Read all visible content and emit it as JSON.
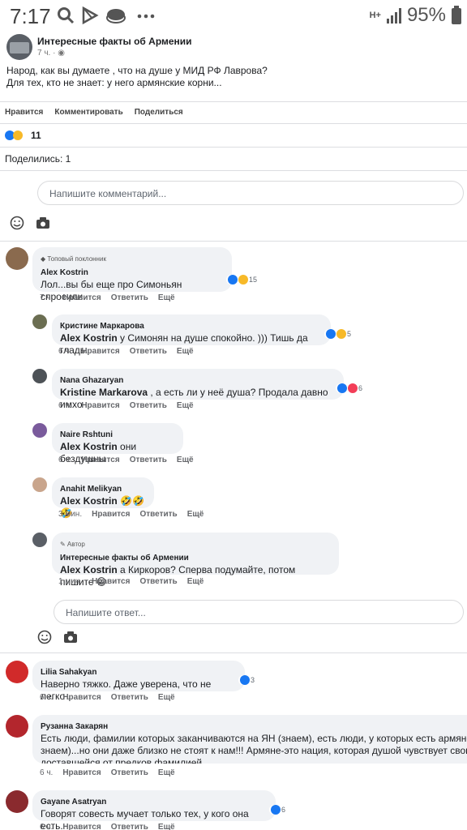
{
  "status": {
    "time": "7:17",
    "battery": "95%",
    "net": "H+"
  },
  "icons": [
    "search-icon",
    "play-store-icon",
    "messages-icon",
    "more-icon",
    "signal-icon"
  ],
  "post": {
    "page_name": "Интересные факты об Армении",
    "time": "7 ч. · ◉",
    "line1": "Народ, как вы думаете , что на душе у МИД РФ Лаврова?",
    "line2": "Для тех, кто не знает: у него армянские корни..."
  },
  "actions": {
    "like": "Нравится",
    "comment": "Комментировать",
    "share": "Поделиться"
  },
  "reactions_count": "11",
  "shares": "Поделились: 1",
  "comment_placeholder": "Напишите комментарий...",
  "reply_placeholder": "Напишите ответ...",
  "meta_labels": {
    "like": "Нравится",
    "reply": "Ответить",
    "more": "Ещё"
  },
  "comments": [
    {
      "badge": "◆ Топовый поклонник",
      "name": "Alex Kostrin",
      "text": "Лол...вы бы еще про Симоньян спросили.",
      "react_count": "15",
      "time": "7 ч."
    },
    {
      "name": "Кристине Маркарова",
      "mention": "Alex Kostrin",
      "text": " у Симонян на душе спокойно. ))) Тишь да гладь.",
      "react_count": "5",
      "time": "6 ч."
    },
    {
      "name": "Nana Ghazaryan",
      "mention": "Kristine Markarova",
      "text": " , а есть ли у неё душа? Продала давно имхо",
      "react_count": "6",
      "time": "6 ч."
    },
    {
      "name": "Naire Rshtuni",
      "mention": "Alex Kostrin",
      "text": " они бездушны",
      "time": "6 ч."
    },
    {
      "name": "Anahit Melikyan",
      "mention": "Alex Kostrin",
      "text": " 🤣🤣🤣",
      "time": "3 мин."
    },
    {
      "badge": "✎ Автор",
      "name": "Интересные факты об Армении",
      "mention": "Alex Kostrin",
      "text": " а Киркоров? Сперва подумайте, потом пишите 😁",
      "time": "1 мин."
    },
    {
      "name": "Lilia Sahakyan",
      "text": "Наверно тяжко. Даже уверена, что не легко .",
      "react_count": "3",
      "time": "6 ч."
    },
    {
      "name": "Рузанна Закарян",
      "text1": "Есть люди, фамилии которых заканчиваются на ЯН (знаем), есть люди, у которых есть армянские корни",
      "text2": "знаем)...но они даже близко не стоят к нам!!! Армяне-это нация, которая душой чувствует свою принадлежность к",
      "text3": "доставшейся от предков фамилией...",
      "time": "6 ч."
    },
    {
      "name": "Gayane Asatryan",
      "text": "Говорят совесть мучает только тех, у кого она есть.",
      "react_count": "6",
      "time": "6 ч."
    }
  ]
}
